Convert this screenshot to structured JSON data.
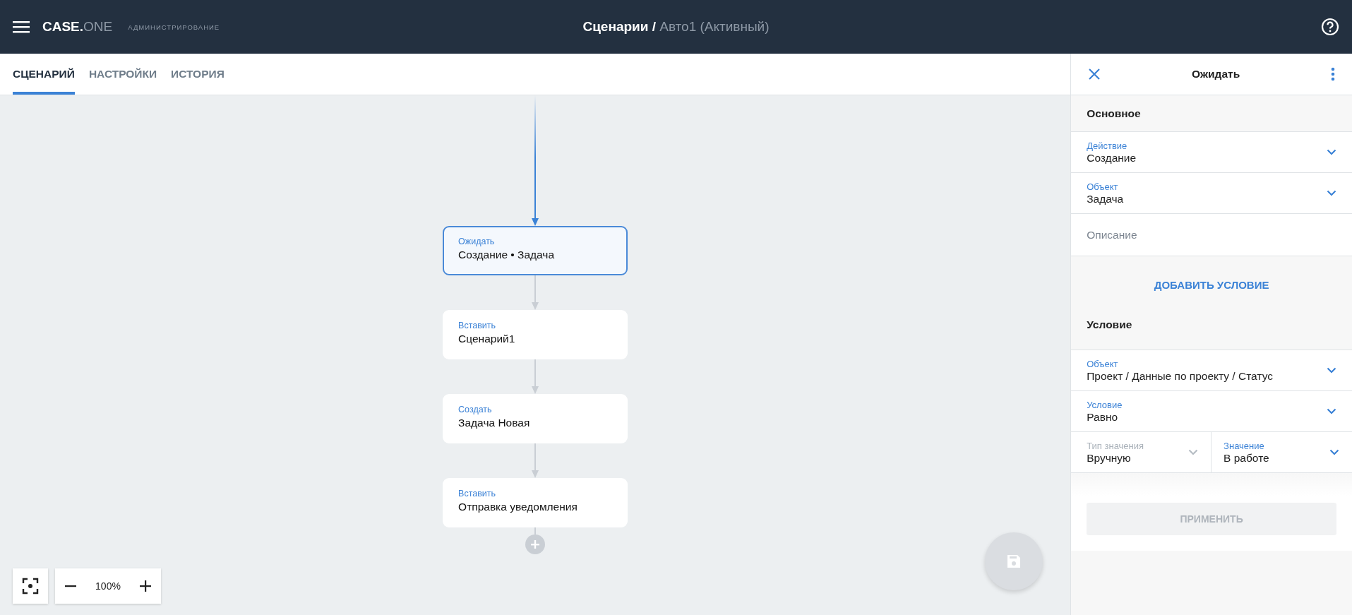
{
  "header": {
    "brand_main": "CASE.",
    "brand_accent": "ONE",
    "section": "АДМИНИСТРИРОВАНИЕ",
    "title": "Сценарии /",
    "subtitle": "Авто1 (Активный)"
  },
  "tabs": [
    {
      "label": "СЦЕНАРИЙ",
      "selected": true
    },
    {
      "label": "НАСТРОЙКИ",
      "selected": false
    },
    {
      "label": "ИСТОРИЯ",
      "selected": false
    }
  ],
  "flow": {
    "nodes": [
      {
        "type": "Ожидать",
        "text": "Создание • Задача",
        "selected": true
      },
      {
        "type": "Вставить",
        "text": "Сценарий1",
        "selected": false
      },
      {
        "type": "Создать",
        "text": "Задача Новая",
        "selected": false
      },
      {
        "type": "Вставить",
        "text": "Отправка уведомления",
        "selected": false
      }
    ]
  },
  "zoom": {
    "value": "100%"
  },
  "panel": {
    "title": "Ожидать",
    "main": {
      "title": "Основное",
      "fields": [
        {
          "kind": "select",
          "label": "Действие",
          "value": "Создание",
          "disabled": false
        },
        {
          "kind": "select",
          "label": "Объект",
          "value": "Задача",
          "disabled": false
        },
        {
          "kind": "text",
          "placeholder": "Описание"
        }
      ]
    },
    "add_condition_button": "ДОБАВИТЬ УСЛОВИЕ",
    "condition": {
      "title": "Условие",
      "fields": [
        {
          "label": "Объект",
          "value": "Проект / Данные по проекту / Статус",
          "disabled": false
        },
        {
          "label": "Условие",
          "value": "Равно",
          "disabled": false
        }
      ],
      "pair": [
        {
          "label": "Тип значения",
          "value": "Вручную",
          "disabled": true
        },
        {
          "label": "Значение",
          "value": "В работе",
          "disabled": false
        }
      ]
    },
    "apply_button": {
      "label": "ПРИМЕНИТЬ",
      "disabled": true
    }
  }
}
